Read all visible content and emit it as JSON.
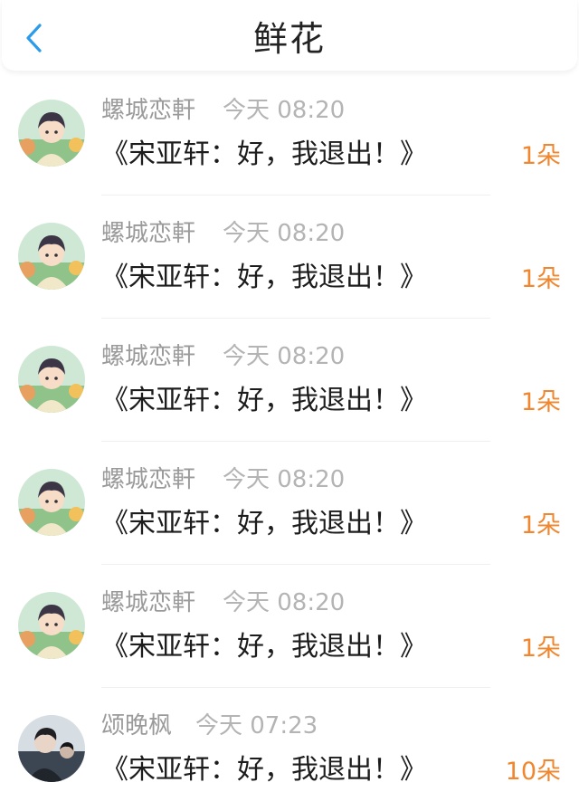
{
  "header": {
    "title": "鲜花",
    "back_icon": "chevron-left-icon",
    "accent_color": "#2b9bea"
  },
  "list": {
    "items": [
      {
        "name": "螺城恋軒",
        "time": "今天 08:20",
        "book": "《宋亚轩：好，我退出！》",
        "count": "1朵",
        "avatar": "cartoon-boy-avatar"
      },
      {
        "name": "螺城恋軒",
        "time": "今天 08:20",
        "book": "《宋亚轩：好，我退出！》",
        "count": "1朵",
        "avatar": "cartoon-boy-avatar"
      },
      {
        "name": "螺城恋軒",
        "time": "今天 08:20",
        "book": "《宋亚轩：好，我退出！》",
        "count": "1朵",
        "avatar": "cartoon-boy-avatar"
      },
      {
        "name": "螺城恋軒",
        "time": "今天 08:20",
        "book": "《宋亚轩：好，我退出！》",
        "count": "1朵",
        "avatar": "cartoon-boy-avatar"
      },
      {
        "name": "螺城恋軒",
        "time": "今天 08:20",
        "book": "《宋亚轩：好，我退出！》",
        "count": "1朵",
        "avatar": "cartoon-boy-avatar"
      },
      {
        "name": "颂晚枫",
        "time": "今天 07:23",
        "book": "《宋亚轩：好，我退出！》",
        "count": "10朵",
        "avatar": "photo-avatar"
      }
    ]
  },
  "colors": {
    "count": "#f0872f",
    "name": "#9a9a9a",
    "time": "#b4b4b4"
  }
}
